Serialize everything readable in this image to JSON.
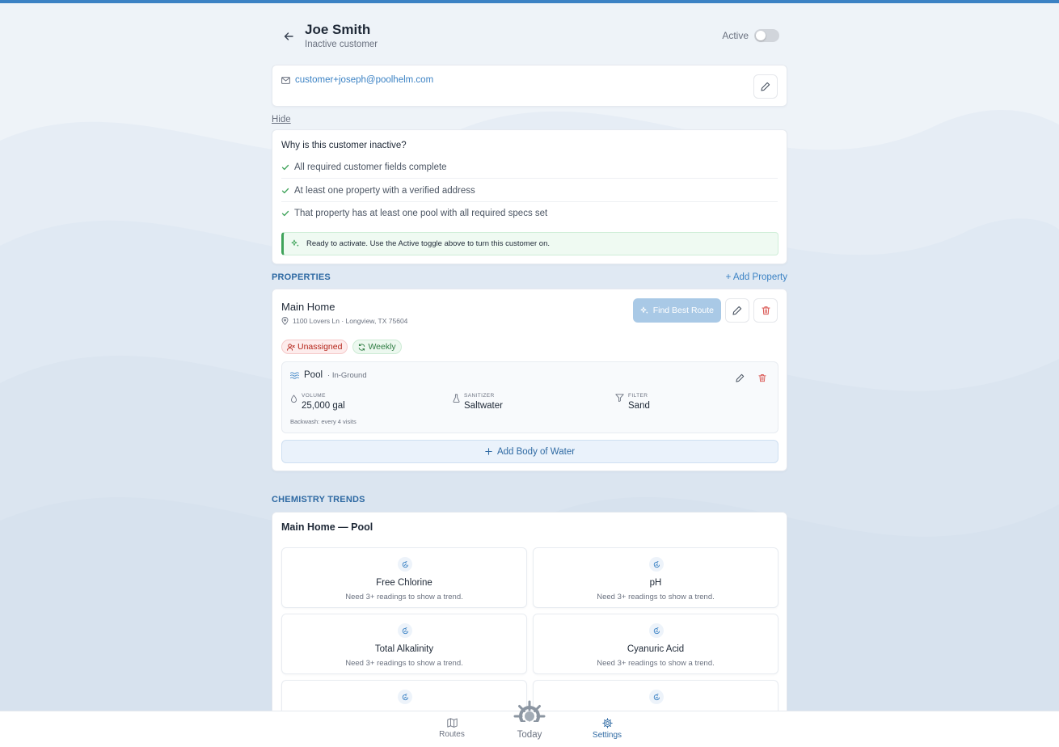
{
  "colors": {
    "accent": "#3b82c4",
    "success": "#3fa35a",
    "danger": "#d9534f"
  },
  "header": {
    "name": "Joe Smith",
    "status": "Inactive customer",
    "active_label": "Active",
    "active_on": false
  },
  "contact": {
    "email": "customer+joseph@poolhelm.com"
  },
  "hide_label": "Hide",
  "inactive_reasons": {
    "title": "Why is this customer inactive?",
    "checks": [
      "All required customer fields complete",
      "At least one property with a verified address",
      "That property has at least one pool with all required specs set"
    ],
    "ready_text": "Ready to activate. Use the Active toggle above to turn this customer on."
  },
  "properties": {
    "section_title": "PROPERTIES",
    "add_label": "+ Add Property",
    "items": [
      {
        "name": "Main Home",
        "address": "1100 Lovers Ln · Longview, TX 75604",
        "route_button": "Find Best Route",
        "badges": [
          "Unassigned",
          "Weekly"
        ],
        "pool": {
          "name": "Pool",
          "type": "· In-Ground",
          "specs": [
            {
              "label": "VOLUME",
              "value": "25,000 gal"
            },
            {
              "label": "SANITIZER",
              "value": "Saltwater"
            },
            {
              "label": "FILTER",
              "value": "Sand"
            }
          ],
          "backwash": "Backwash: every 4 visits"
        },
        "add_water_label": "Add Body of Water"
      }
    ]
  },
  "chemistry": {
    "section_title": "CHEMISTRY TRENDS",
    "card_title": "Main Home — Pool",
    "tiles": [
      {
        "name": "Free Chlorine",
        "note": "Need 3+ readings to show a trend."
      },
      {
        "name": "pH",
        "note": "Need 3+ readings to show a trend."
      },
      {
        "name": "Total Alkalinity",
        "note": "Need 3+ readings to show a trend."
      },
      {
        "name": "Cyanuric Acid",
        "note": "Need 3+ readings to show a trend."
      }
    ]
  },
  "nav": {
    "routes": "Routes",
    "today": "Today",
    "settings": "Settings",
    "active": "settings"
  }
}
